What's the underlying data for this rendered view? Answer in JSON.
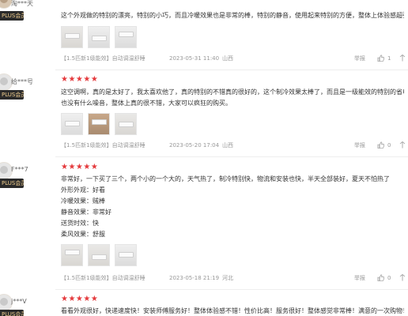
{
  "reviews": [
    {
      "username": "淘***天",
      "badge": "PLUS会员",
      "stars": "★★★★★",
      "content": "这个外观做的特别的漂亮，特别的小巧，而且冷暖效果也是非常的棒，特别的静音，使用起来特别的方便，整体上体验感超强。",
      "attributes": [],
      "product": "【1.5匹新1级能效】自动调温舒睡",
      "date": "2023-05-31 11:40",
      "region": "山西",
      "report_label": "举报",
      "likes": "1"
    },
    {
      "username": "给***号",
      "badge": "PLUS会员",
      "stars": "★★★★★",
      "content_lines": [
        "这空调啊，真的是太好了，我太喜欢他了，真的特别的不错真的很好的，这个制冷效果太棒了，而且是一级能效的特别的省电，",
        "也没有什么噪音，整体上真的很不错，大家可以疯狂的购买。"
      ],
      "attributes": [],
      "product": "【1.5匹新1级能效】自动调温舒睡",
      "date": "2023-05-20 17:04",
      "region": "山西",
      "report_label": "举报",
      "likes": "0"
    },
    {
      "username": "F***7",
      "badge": "PLUS会员",
      "stars": "★★★★★",
      "content": "非常好，一下买了三个，两个小的一个大的，天气热了，制冷特别快，物流和安装也快，半天全部装好，夏天不怕热了",
      "attributes": [
        "外形外观：好看",
        "冷暖效果：贼棒",
        "静音效果：非常好",
        "送货时效：快",
        "柔风效果：舒服"
      ],
      "product": "【1.5匹新1级能效】自动调温舒睡",
      "date": "2023-05-18 21:19",
      "region": "河北",
      "report_label": "举报",
      "likes": "0"
    },
    {
      "username": "j***V",
      "badge": "PLUS会员",
      "stars": "★★★★★",
      "content": "看看外观很好，快递速度快！安装师傅服务好！整体体验感不错！性价比高！服务很好！整体感觉非常棒！满意的一次购物！"
    }
  ],
  "colors": {
    "star": "#e4393c",
    "badge_bg": "#2b2b2b",
    "badge_text": "#f2cf8f",
    "meta": "#999999"
  },
  "icons": {
    "like": "thumbs-up-icon",
    "more": "more-icon"
  }
}
